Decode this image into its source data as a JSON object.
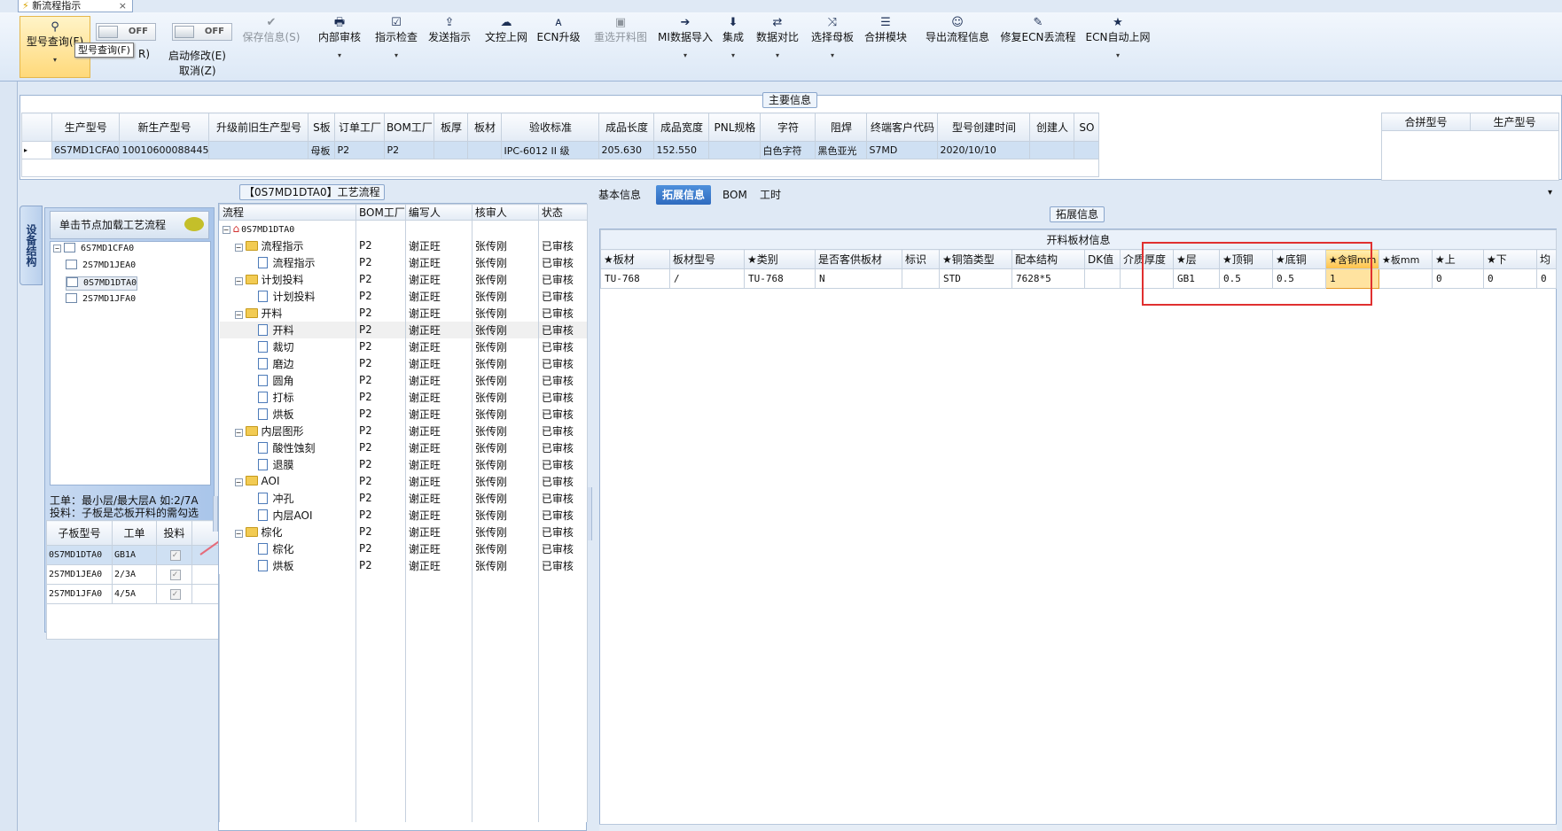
{
  "window": {
    "doc_tab": "新流程指示",
    "close": "×"
  },
  "ribbon": {
    "query": {
      "label": "型号查询(F)",
      "icon": "search-icon"
    },
    "toggle1": {
      "state": "OFF",
      "label": "R)"
    },
    "toggle2": {
      "state": "OFF",
      "label": "启动修改(E)",
      "sub": "取消(Z)"
    },
    "tooltip": "型号查询(F)",
    "buttons": [
      {
        "label": "保存信息(S)",
        "icon": "✔",
        "disabled": true
      },
      {
        "label": "内部审核",
        "icon": "🖶"
      },
      {
        "label": "指示检查",
        "icon": "☑"
      },
      {
        "label": "发送指示",
        "icon": "⇪"
      },
      {
        "label": "文控上网",
        "icon": "☁"
      },
      {
        "label": "ECN升级",
        "icon": "ᴀ"
      },
      {
        "label": "重选开料图",
        "icon": "▣",
        "disabled": true
      },
      {
        "label": "MI数据导入",
        "icon": "➔"
      },
      {
        "label": "集成",
        "icon": "⬇"
      },
      {
        "label": "数据对比",
        "icon": "⇄"
      },
      {
        "label": "选择母板",
        "icon": "⤨"
      },
      {
        "label": "合拼模块",
        "icon": "☰"
      },
      {
        "label": "导出流程信息",
        "icon": "☺"
      },
      {
        "label": "修复ECN丢流程",
        "icon": "✎"
      },
      {
        "label": "ECN自动上网",
        "icon": "★"
      }
    ],
    "dropdown_glyph": "▾"
  },
  "main_info": {
    "title": "主要信息",
    "columns": [
      "生产型号",
      "新生产型号",
      "升级前旧生产型号",
      "S板",
      "订单工厂",
      "BOM工厂",
      "板厚",
      "板材",
      "验收标准",
      "成品长度",
      "成品宽度",
      "PNL规格",
      "字符",
      "阻焊",
      "终端客户代码",
      "型号创建时间",
      "创建人",
      "SO"
    ],
    "row": [
      "6S7MD1CFA0",
      "10010600088445",
      "",
      "母板",
      "P2",
      "P2",
      "",
      "",
      "IPC-6012 II 级",
      "205.630",
      "152.550",
      "",
      "白色字符",
      "黑色亚光",
      "S7MD",
      "2020/10/10",
      "",
      ""
    ],
    "merge_columns": [
      "合拼型号",
      "生产型号"
    ]
  },
  "left": {
    "vtab": "设备结构",
    "load_button": "单击节点加载工艺流程",
    "tree": [
      {
        "label": "6S7MD1CFA0",
        "level": 0
      },
      {
        "label": "2S7MD1JEA0",
        "level": 1
      },
      {
        "label": "0S7MD1DTA0",
        "level": 1,
        "selected": true
      },
      {
        "label": "2S7MD1JFA0",
        "level": 1
      }
    ],
    "note1": "工单：最小层/最大层A 如:2/7A",
    "note2": "投料：子板是芯板开料的需勾选",
    "sub_columns": [
      "子板型号",
      "工单",
      "投料"
    ],
    "sub_rows": [
      {
        "model": "0S7MD1DTA0",
        "order": "GB1A",
        "feed": "✓"
      },
      {
        "model": "2S7MD1JEA0",
        "order": "2/3A",
        "feed": "✓"
      },
      {
        "model": "2S7MD1JFA0",
        "order": "4/5A",
        "feed": "✓"
      }
    ]
  },
  "process": {
    "title": "【0S7MD1DTA0】工艺流程",
    "columns": [
      "流程",
      "BOM工厂",
      "编写人",
      "核审人",
      "状态"
    ],
    "root": "0S7MD1DTA0",
    "rows": [
      {
        "name": "流程指示",
        "type": "folder",
        "factory": "P2",
        "writer": "谢正旺",
        "checker": "张传刚",
        "status": "已审核"
      },
      {
        "name": "流程指示",
        "type": "doc",
        "factory": "P2",
        "writer": "谢正旺",
        "checker": "张传刚",
        "status": "已审核"
      },
      {
        "name": "计划投料",
        "type": "folder",
        "factory": "P2",
        "writer": "谢正旺",
        "checker": "张传刚",
        "status": "已审核"
      },
      {
        "name": "计划投料",
        "type": "doc",
        "factory": "P2",
        "writer": "谢正旺",
        "checker": "张传刚",
        "status": "已审核"
      },
      {
        "name": "开料",
        "type": "folder",
        "factory": "P2",
        "writer": "谢正旺",
        "checker": "张传刚",
        "status": "已审核"
      },
      {
        "name": "开料",
        "type": "doc",
        "factory": "P2",
        "writer": "谢正旺",
        "checker": "张传刚",
        "status": "已审核",
        "hl": true
      },
      {
        "name": "裁切",
        "type": "doc",
        "factory": "P2",
        "writer": "谢正旺",
        "checker": "张传刚",
        "status": "已审核"
      },
      {
        "name": "磨边",
        "type": "doc",
        "factory": "P2",
        "writer": "谢正旺",
        "checker": "张传刚",
        "status": "已审核"
      },
      {
        "name": "圆角",
        "type": "doc",
        "factory": "P2",
        "writer": "谢正旺",
        "checker": "张传刚",
        "status": "已审核"
      },
      {
        "name": "打标",
        "type": "doc",
        "factory": "P2",
        "writer": "谢正旺",
        "checker": "张传刚",
        "status": "已审核"
      },
      {
        "name": "烘板",
        "type": "doc",
        "factory": "P2",
        "writer": "谢正旺",
        "checker": "张传刚",
        "status": "已审核"
      },
      {
        "name": "内层图形",
        "type": "folder",
        "factory": "P2",
        "writer": "谢正旺",
        "checker": "张传刚",
        "status": "已审核"
      },
      {
        "name": "酸性蚀刻",
        "type": "doc",
        "factory": "P2",
        "writer": "谢正旺",
        "checker": "张传刚",
        "status": "已审核"
      },
      {
        "name": "退膜",
        "type": "doc",
        "factory": "P2",
        "writer": "谢正旺",
        "checker": "张传刚",
        "status": "已审核"
      },
      {
        "name": "AOI",
        "type": "folder",
        "factory": "P2",
        "writer": "谢正旺",
        "checker": "张传刚",
        "status": "已审核"
      },
      {
        "name": "冲孔",
        "type": "doc",
        "factory": "P2",
        "writer": "谢正旺",
        "checker": "张传刚",
        "status": "已审核"
      },
      {
        "name": "内层AOI",
        "type": "doc",
        "factory": "P2",
        "writer": "谢正旺",
        "checker": "张传刚",
        "status": "已审核"
      },
      {
        "name": "棕化",
        "type": "folder",
        "factory": "P2",
        "writer": "谢正旺",
        "checker": "张传刚",
        "status": "已审核"
      },
      {
        "name": "棕化",
        "type": "doc",
        "factory": "P2",
        "writer": "谢正旺",
        "checker": "张传刚",
        "status": "已审核"
      },
      {
        "name": "烘板",
        "type": "doc",
        "factory": "P2",
        "writer": "谢正旺",
        "checker": "张传刚",
        "status": "已审核"
      }
    ]
  },
  "right": {
    "tabs": [
      "基本信息",
      "拓展信息",
      "BOM",
      "工时"
    ],
    "active_tab": "拓展信息",
    "panel_title": "拓展信息",
    "table_caption": "开料板材信息",
    "columns": [
      "★板材",
      "板材型号",
      "★类别",
      "是否客供板材",
      "标识",
      "★铜箔类型",
      "配本结构",
      "DK值",
      "介质厚度",
      "★层",
      "★顶铜",
      "★底铜",
      "★含铜mm",
      "★板mm",
      "★上",
      "★下",
      "均"
    ],
    "row": [
      "TU-768",
      "/",
      "TU-768",
      "N",
      "",
      "STD",
      "7628*5",
      "",
      "",
      "GB1",
      "0.5",
      "0.5",
      "1",
      "",
      "0",
      "0",
      "0"
    ]
  }
}
